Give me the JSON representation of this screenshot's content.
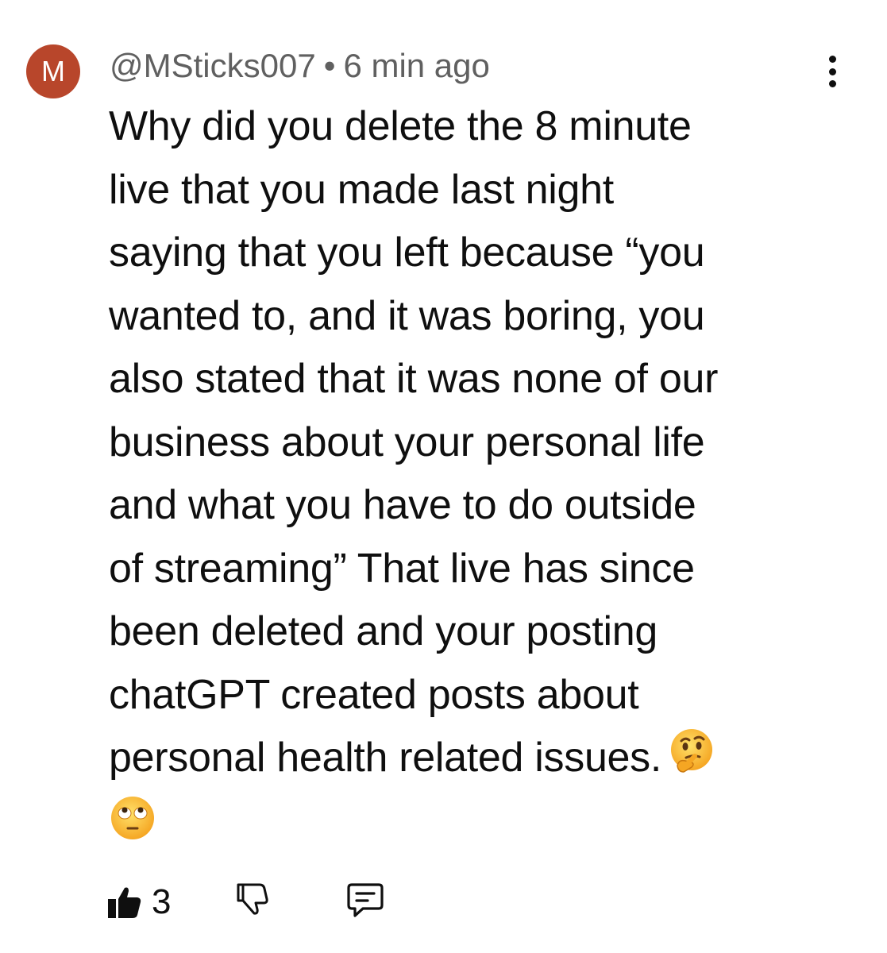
{
  "comment": {
    "avatar_letter": "M",
    "avatar_color": "#b8462b",
    "author": "@MSticks007",
    "separator": "•",
    "time": "6 min ago",
    "lines": [
      "Why did you delete the 8 minute",
      "live that you made last night",
      "saying that you left because “you",
      "wanted to, and it was boring, you",
      "also stated that it was none of our",
      "business about your personal life",
      "and what you have to do outside",
      "of streaming” That live has since",
      "been deleted and your posting",
      "chatGPT created posts about",
      "personal health related issues."
    ],
    "emojis": [
      "thinking-face-emoji",
      "eye-roll-emoji"
    ],
    "like_count": "3",
    "icons": {
      "menu": "more-vertical-icon",
      "like": "thumbs-up-filled-icon",
      "dislike": "thumbs-down-outline-icon",
      "reply": "comment-reply-icon"
    }
  }
}
